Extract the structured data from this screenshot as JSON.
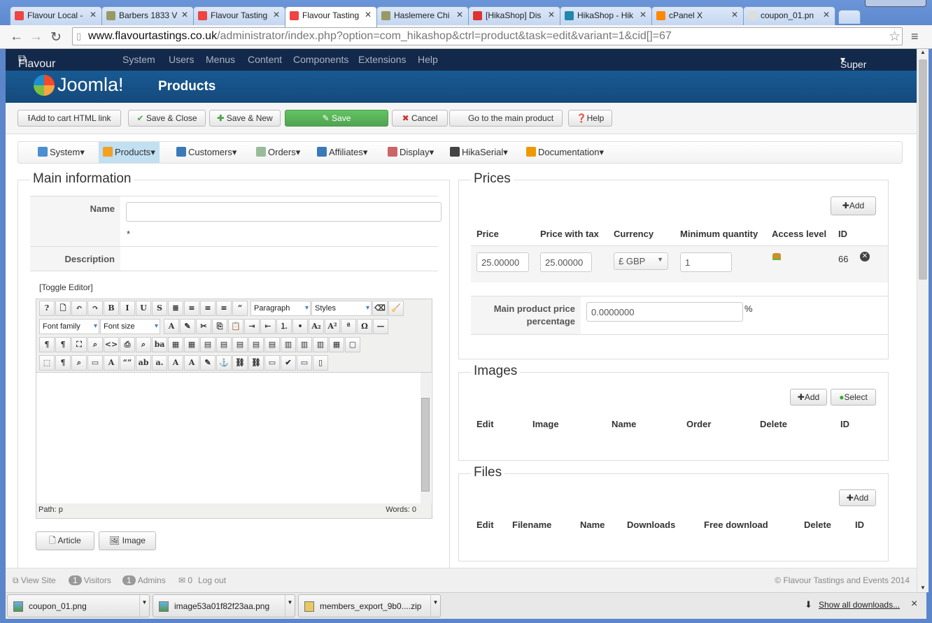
{
  "browser": {
    "tabs": [
      {
        "title": "Flavour Local -",
        "color": "#e44"
      },
      {
        "title": "Barbers 1833 V",
        "color": "#996"
      },
      {
        "title": "Flavour Tasting",
        "color": "#e44"
      },
      {
        "title": "Flavour Tasting",
        "color": "#e44",
        "active": true
      },
      {
        "title": "Haslemere Chi",
        "color": "#996"
      },
      {
        "title": "[HikaShop] Dis",
        "color": "#d33"
      },
      {
        "title": "HikaShop - Hik",
        "color": "#28a"
      },
      {
        "title": "cPanel X",
        "color": "#f80"
      },
      {
        "title": "coupon_01.pn",
        "color": "#ddd"
      }
    ],
    "url_host": "www.flavourtastings.co.uk",
    "url_path": "/administrator/index.php?option=com_hikashop&ctrl=product&task=edit&variant=1&cid[]=67"
  },
  "joomla": {
    "site_name": "Flavour Tastin...",
    "menu": [
      "System",
      "Users",
      "Menus",
      "Content",
      "Components",
      "Extensions",
      "Help"
    ],
    "user": "Super User",
    "logo": "Joomla!",
    "page_title": "Products"
  },
  "toolbar": {
    "add_to_cart": "Add to cart HTML link",
    "save_close": "Save & Close",
    "save_new": "Save & New",
    "save": "Save",
    "cancel": "Cancel",
    "main_product": "Go to the main product",
    "help": "Help"
  },
  "hika_menu": [
    {
      "label": "System",
      "color": "#4a8fd0"
    },
    {
      "label": "Products",
      "color": "#f4a020",
      "active": true
    },
    {
      "label": "Customers",
      "color": "#3a7ab8"
    },
    {
      "label": "Orders",
      "color": "#9b9"
    },
    {
      "label": "Affiliates",
      "color": "#3a7ab8"
    },
    {
      "label": "Display",
      "color": "#c66"
    },
    {
      "label": "HikaSerial",
      "color": "#444"
    },
    {
      "label": "Documentation",
      "color": "#e90"
    }
  ],
  "main_info": {
    "legend": "Main information",
    "name_label": "Name",
    "name_value": "",
    "required": "*",
    "description_label": "Description",
    "toggle_editor": "[Toggle Editor]",
    "editor": {
      "paragraph": "Paragraph",
      "styles": "Styles",
      "font_family": "Font family",
      "font_size": "Font size",
      "path_label": "Path:",
      "path_value": "p",
      "words": "Words: 0",
      "rows": [
        [
          "help",
          "new-document",
          "undo",
          "redo",
          "bold",
          "italic",
          "underline",
          "strikethrough",
          "justify",
          "align-center",
          "align-left",
          "align-right",
          "blockquote"
        ],
        [
          "text-color",
          "highlight",
          "cut",
          "copy",
          "paste",
          "indent",
          "outdent",
          "ordered-list",
          "unordered-list",
          "subscript",
          "superscript",
          "font-case",
          "special-char",
          "horizontal-rule"
        ],
        [
          "ltr",
          "rtl",
          "fullscreen",
          "preview",
          "code",
          "print",
          "find",
          "replace",
          "table",
          "delete-table",
          "row-props",
          "cell-props",
          "row-before",
          "row-after",
          "delete-row",
          "col-before",
          "col-after",
          "delete-col",
          "merge",
          "split"
        ],
        [
          "visual-aid",
          "show-blocks",
          "template",
          "layer",
          "style",
          "cite",
          "abbr",
          "acronym",
          "del",
          "ins",
          "attribs",
          "anchor",
          "unlink",
          "link",
          "image",
          "spellcheck",
          "pagebreak",
          "readmore"
        ]
      ]
    },
    "article_button": "Article",
    "image_button": "Image"
  },
  "prices": {
    "legend": "Prices",
    "add": "Add",
    "headers": [
      "Price",
      "Price with tax",
      "Currency",
      "Minimum quantity",
      "Access level",
      "ID"
    ],
    "row": {
      "price": "25.00000",
      "price_tax": "25.00000",
      "currency": "£ GBP",
      "min_qty": "1",
      "id": "66"
    },
    "main_pct_label": "Main product price percentage",
    "main_pct_value": "0.0000000",
    "pct": "%"
  },
  "images": {
    "legend": "Images",
    "add": "Add",
    "select": "Select",
    "headers": [
      "Edit",
      "Image",
      "Name",
      "Order",
      "Delete",
      "ID"
    ]
  },
  "files": {
    "legend": "Files",
    "add": "Add",
    "headers": [
      "Edit",
      "Filename",
      "Name",
      "Downloads",
      "Free download",
      "Delete",
      "ID"
    ]
  },
  "footer": {
    "view_site": "View Site",
    "visitors_count": "1",
    "visitors": "Visitors",
    "admins_count": "1",
    "admins": "Admins",
    "messages_count": "0",
    "logout": "Log out",
    "copyright": "© Flavour Tastings and Events 2014"
  },
  "downloads": {
    "items": [
      "coupon_01.png",
      "image53a01f82f23aa.png",
      "members_export_9b0....zip"
    ],
    "show_all": "Show all downloads...",
    "close": "×"
  }
}
